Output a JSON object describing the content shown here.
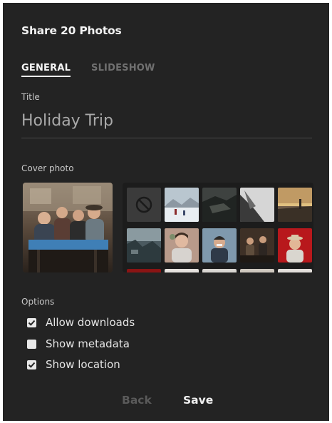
{
  "dialog": {
    "title": "Share 20 Photos",
    "tabs": [
      {
        "label": "GENERAL",
        "active": true
      },
      {
        "label": "SLIDESHOW",
        "active": false
      }
    ],
    "title_field": {
      "label": "Title",
      "value": "Holiday Trip"
    },
    "cover": {
      "label": "Cover photo",
      "no_cover_icon": "no-cover-icon"
    },
    "options": {
      "label": "Options",
      "items": [
        {
          "label": "Allow downloads",
          "checked": true
        },
        {
          "label": "Show metadata",
          "checked": false
        },
        {
          "label": "Show location",
          "checked": true
        }
      ]
    },
    "footer": {
      "back_label": "Back",
      "save_label": "Save"
    }
  },
  "colors": {
    "background": "#232323",
    "accent": "#f4f4f4",
    "disabled": "#5a5a5a"
  }
}
